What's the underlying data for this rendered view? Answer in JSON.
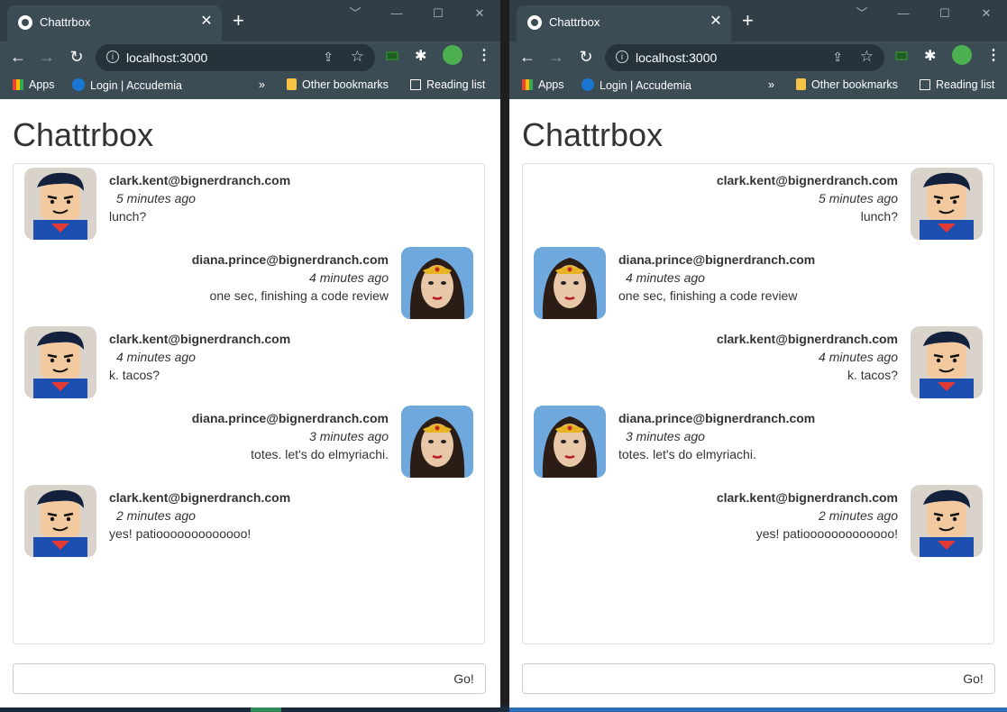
{
  "browser": {
    "tab_title": "Chattrbox",
    "url": "localhost:3000",
    "bookmarks": {
      "apps": "Apps",
      "login": "Login | Accudemia",
      "more": "»",
      "other": "Other bookmarks",
      "reading": "Reading list"
    },
    "accent": "#3c4c54"
  },
  "left": {
    "title": "Chattrbox",
    "messages": [
      {
        "user": "clark.kent@bignerdranch.com",
        "time": "5 minutes ago",
        "text": "lunch?",
        "side": "left",
        "avatar": "superman-avatar"
      },
      {
        "user": "diana.prince@bignerdranch.com",
        "time": "4 minutes ago",
        "text": "one sec, finishing a code review",
        "side": "right",
        "avatar": "wonder-woman-avatar"
      },
      {
        "user": "clark.kent@bignerdranch.com",
        "time": "4 minutes ago",
        "text": "k. tacos?",
        "side": "left",
        "avatar": "superman-avatar"
      },
      {
        "user": "diana.prince@bignerdranch.com",
        "time": "3 minutes ago",
        "text": "totes. let's do elmyriachi.",
        "side": "right",
        "avatar": "wonder-woman-avatar"
      },
      {
        "user": "clark.kent@bignerdranch.com",
        "time": "2 minutes ago",
        "text": "yes! patiooooooooooooo!",
        "side": "left",
        "avatar": "superman-avatar"
      }
    ],
    "input_value": "",
    "send_label": "Go!"
  },
  "right": {
    "title": "Chattrbox",
    "messages": [
      {
        "user": "clark.kent@bignerdranch.com",
        "time": "5 minutes ago",
        "text": "lunch?",
        "side": "right",
        "avatar": "superman-avatar"
      },
      {
        "user": "diana.prince@bignerdranch.com",
        "time": "4 minutes ago",
        "text": "one sec, finishing a code review",
        "side": "left",
        "avatar": "wonder-woman-avatar"
      },
      {
        "user": "clark.kent@bignerdranch.com",
        "time": "4 minutes ago",
        "text": "k. tacos?",
        "side": "right",
        "avatar": "superman-avatar"
      },
      {
        "user": "diana.prince@bignerdranch.com",
        "time": "3 minutes ago",
        "text": "totes. let's do elmyriachi.",
        "side": "left",
        "avatar": "wonder-woman-avatar"
      },
      {
        "user": "clark.kent@bignerdranch.com",
        "time": "2 minutes ago",
        "text": "yes! patiooooooooooooo!",
        "side": "right",
        "avatar": "superman-avatar"
      }
    ],
    "input_value": "",
    "send_label": "Go!"
  }
}
